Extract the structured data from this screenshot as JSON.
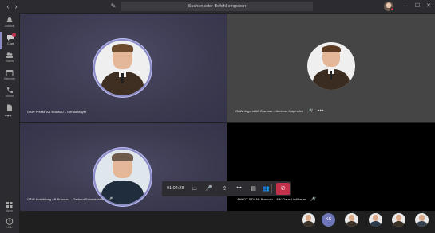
{
  "titlebar": {
    "search_placeholder": "Suchen oder Befehl eingeben",
    "icons": [
      "back-arrow-icon",
      "forward-arrow-icon",
      "compose-icon",
      "minimize-icon",
      "maximize-icon",
      "close-icon"
    ],
    "back": "‹",
    "forward": "›",
    "compose": "✎",
    "minimize": "—",
    "maximize": "☐",
    "close": "✕"
  },
  "rail": {
    "items": [
      {
        "label": "Aktivität",
        "icon": "bell-icon"
      },
      {
        "label": "Chat",
        "icon": "chat-icon"
      },
      {
        "label": "Teams",
        "icon": "teams-icon"
      },
      {
        "label": "Kalender",
        "icon": "calendar-icon"
      },
      {
        "label": "Anrufe",
        "icon": "phone-icon"
      },
      {
        "label": "Dateien",
        "icon": "files-icon"
      }
    ],
    "more": "•••",
    "bottom": [
      {
        "label": "Apps",
        "icon": "apps-icon"
      },
      {
        "label": "Hilfe",
        "icon": "help-icon"
      }
    ]
  },
  "tiles": [
    {
      "name": "OÄW Presse AB Braunau – Gerald Mayer",
      "mic_icon": "",
      "more": ""
    },
    {
      "name": "OÄW Jugend AB Braunau – Andreas Mayrhofer",
      "mic_icon": "🎤̸",
      "more": "•••"
    },
    {
      "name": "OÄW Ausbildung AB Braunau – Gerhard Schmiddaller",
      "mic_icon": "🎤̸",
      "more": ""
    },
    {
      "name": "AHKDT-STV AB Braunau – AW Klaus Lindlbauer",
      "mic_icon": "🎤̸",
      "more": ""
    }
  ],
  "controls": {
    "timer": "01:04:28",
    "video": "▭",
    "mute": "🎤",
    "share": "⇪",
    "more": "•••",
    "chat": "▤",
    "participants": "👥",
    "hangup": "✆"
  },
  "strip": {
    "initials": "KS"
  },
  "colors": {
    "accent": "#8b8cc7",
    "hangup": "#c4314b",
    "rail_bg": "#2b2b30",
    "tile_purple": "#3b3a4f"
  }
}
